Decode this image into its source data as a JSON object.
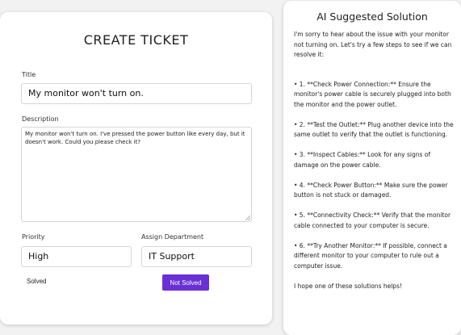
{
  "create_ticket": {
    "heading": "CREATE TICKET",
    "title_label": "Title",
    "title_value": "My monitor won't turn on.",
    "description_label": "Description",
    "description_value": "My monitor won't turn on. I've pressed the power button like every day, but it doesn't work. Could you please check it?",
    "priority_label": "Priority",
    "priority_value": "High",
    "department_label": "Assign Department",
    "department_value": "IT Support",
    "solved_label": "Solved",
    "not_solved_label": "Not Solved"
  },
  "ai_solution": {
    "heading": "AI Suggested Solution",
    "intro": "I'm sorry to hear about the issue with your monitor not turning on. Let's try a few steps to see if we can resolve it:",
    "steps": [
      "• 1. **Check Power Connection:** Ensure the monitor's power cable is securely plugged into both the monitor and the power outlet.",
      "• 2. **Test the Outlet:** Plug another device into the same outlet to verify that the outlet is functioning.",
      "• 3. **Inspect Cables:** Look for any signs of damage on the power cable.",
      "• 4. **Check Power Button:** Make sure the power button is not stuck or damaged.",
      "• 5. **Connectivity Check:** Verify that the monitor cable connected to your computer is secure.",
      "• 6. **Try Another Monitor:** If possible, connect a different monitor to your computer to rule out a computer issue."
    ],
    "outro": "I hope one of these solutions helps!"
  },
  "colors": {
    "accent": "#6b2fd6",
    "background": "#f2f2f2",
    "card": "#ffffff"
  }
}
